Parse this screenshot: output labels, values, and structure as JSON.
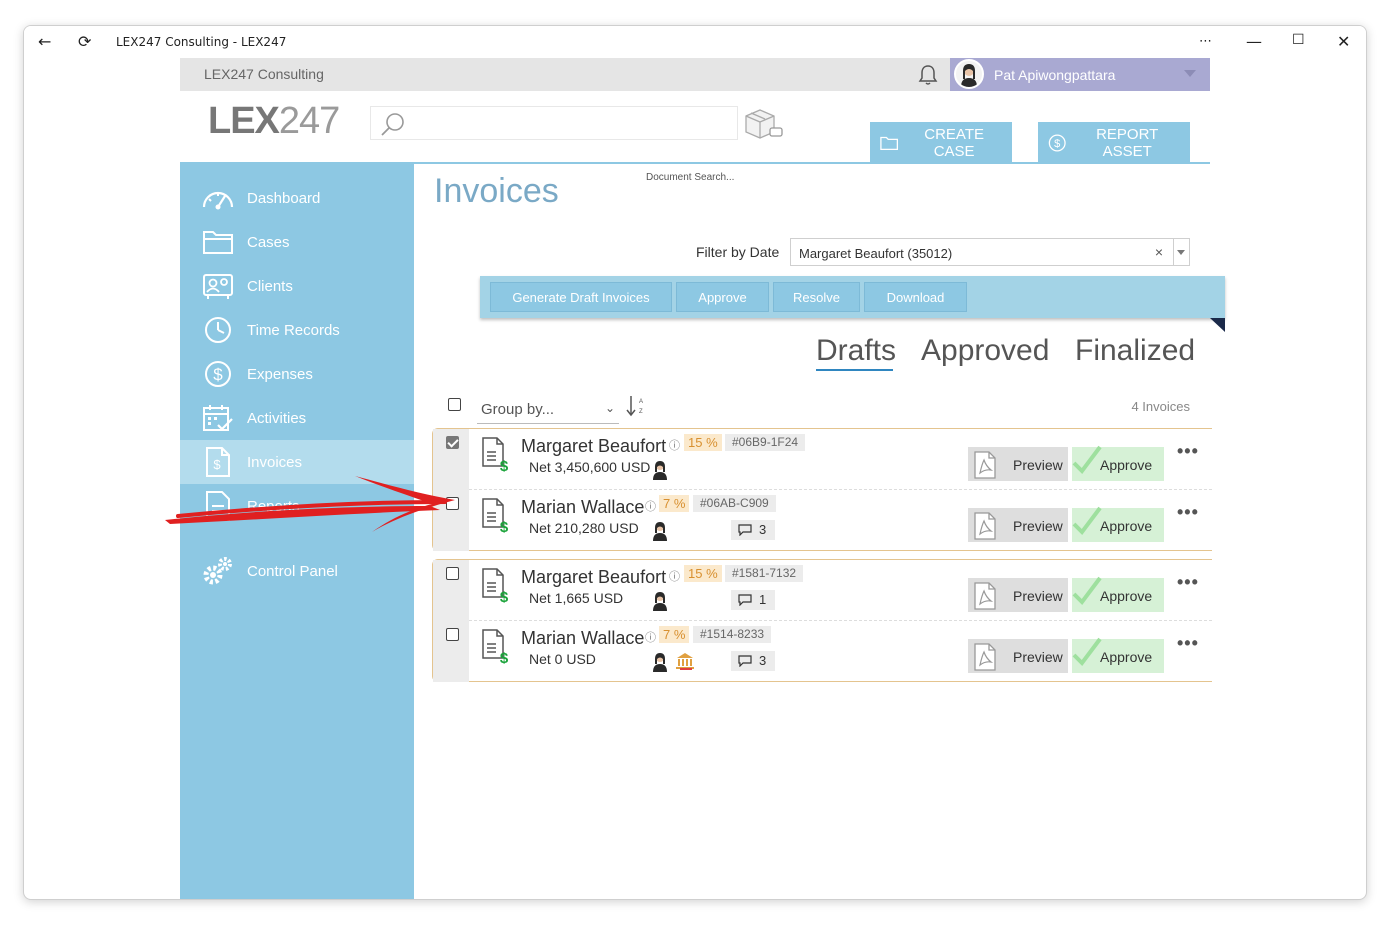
{
  "window": {
    "title": "LEX247 Consulting - LEX247"
  },
  "topbar": {
    "org_name": "LEX247 Consulting",
    "user_name": "Pat Apiwongpattara"
  },
  "header": {
    "logo_bold": "LEX",
    "logo_thin": "247",
    "search_placeholder": "",
    "search_label": "Document Search...",
    "create_case": "CREATE CASE",
    "report_asset": "REPORT ASSET"
  },
  "sidebar": {
    "items": [
      {
        "label": "Dashboard",
        "icon": "dashboard-icon"
      },
      {
        "label": "Cases",
        "icon": "folder-icon"
      },
      {
        "label": "Clients",
        "icon": "clients-icon"
      },
      {
        "label": "Time Records",
        "icon": "clock-icon"
      },
      {
        "label": "Expenses",
        "icon": "dollar-circle-icon"
      },
      {
        "label": "Activities",
        "icon": "calendar-icon"
      },
      {
        "label": "Invoices",
        "icon": "invoice-icon",
        "active": true
      },
      {
        "label": "Reports",
        "icon": "report-icon"
      },
      {
        "label": "Control Panel",
        "icon": "gears-icon"
      }
    ]
  },
  "main": {
    "title": "Invoices",
    "filter_label": "Filter by Date",
    "filter_value": "Margaret Beaufort (35012)",
    "actions": [
      "Generate Draft Invoices",
      "Approve",
      "Resolve",
      "Download"
    ],
    "tabs": [
      {
        "label": "Drafts",
        "active": true
      },
      {
        "label": "Approved"
      },
      {
        "label": "Finalized"
      }
    ],
    "group_by": "Group by...",
    "count": "4 Invoices",
    "preview_label": "Preview",
    "approve_label": "Approve",
    "more_label": "•••",
    "invoices": [
      {
        "client": "Margaret Beaufort",
        "pct": "15 %",
        "id": "#06B9-1F24",
        "net": "Net 3,450,600 USD",
        "comments": "",
        "checked": true
      },
      {
        "client": "Marian Wallace",
        "pct": "7 %",
        "id": "#06AB-C909",
        "net": "Net 210,280 USD",
        "comments": "3",
        "checked": false
      },
      {
        "client": "Margaret Beaufort",
        "pct": "15 %",
        "id": "#1581-7132",
        "net": "Net 1,665 USD",
        "comments": "1",
        "checked": false
      },
      {
        "client": "Marian Wallace",
        "pct": "7 %",
        "id": "#1514-8233",
        "net": "Net 0 USD",
        "comments": "3",
        "checked": false
      }
    ]
  },
  "colors": {
    "accent": "#8dc8e3",
    "accent_light": "#b3dced",
    "title": "#7aa9c6",
    "user_bar": "#a9a9d2",
    "pct_badge_bg": "#fbe9cc",
    "pct_badge_fg": "#d89030",
    "approve_bg": "#d6f1d6",
    "group_border": "#e4c48f",
    "annotation_arrow": "#e02020"
  }
}
